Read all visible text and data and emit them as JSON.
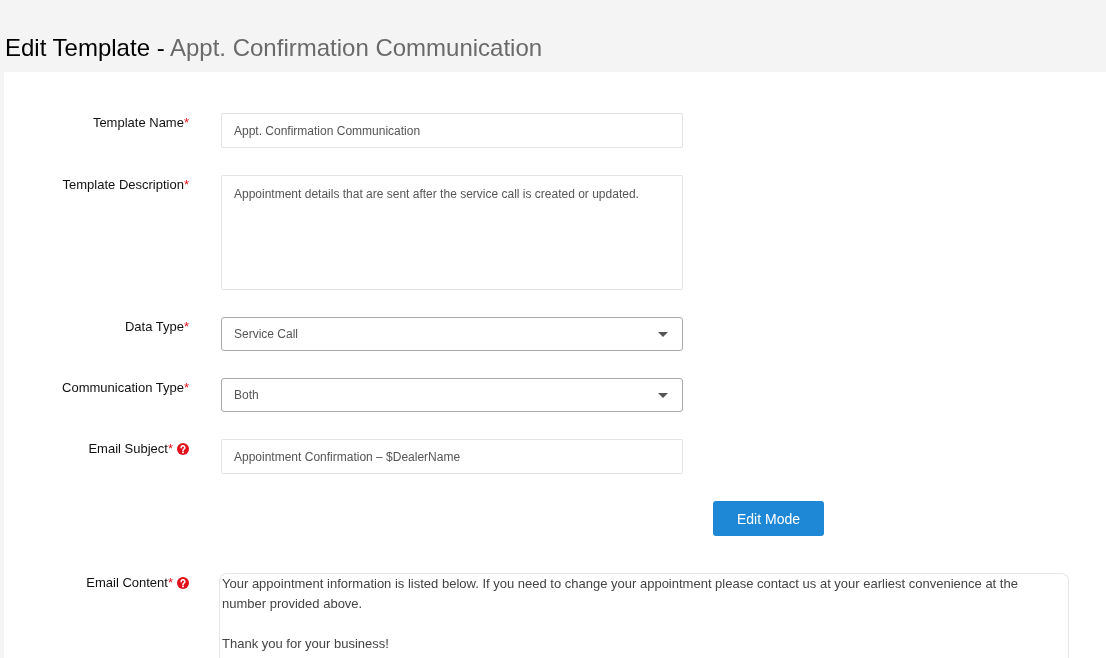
{
  "page": {
    "title": "Edit Template -",
    "subtitle": "Appt. Confirmation Communication"
  },
  "fields": [
    {
      "kind": "input",
      "label": "Template Name",
      "required_mark": "*",
      "help": false,
      "value": "Appt. Confirmation Communication"
    },
    {
      "kind": "textarea",
      "label": "Template Description",
      "required_mark": "*",
      "help": false,
      "value": "Appointment details that are sent after the service call is created or updated."
    },
    {
      "kind": "select",
      "label": "Data Type",
      "required_mark": "*",
      "help": false,
      "value": "Service Call"
    },
    {
      "kind": "select",
      "label": "Communication Type",
      "required_mark": "*",
      "help": false,
      "value": "Both"
    },
    {
      "kind": "input",
      "label": "Email Subject",
      "required_mark": "*",
      "help": true,
      "value": "Appointment Confirmation – $DealerName"
    }
  ],
  "edit_mode_button": "Edit Mode",
  "email_content": {
    "label": "Email Content",
    "required_mark": "*",
    "help": true,
    "paragraphs": [
      "Your appointment information is listed below. If you need to change your appointment please contact us at your earliest convenience at the number provided above.",
      "Thank you for your business!"
    ]
  }
}
